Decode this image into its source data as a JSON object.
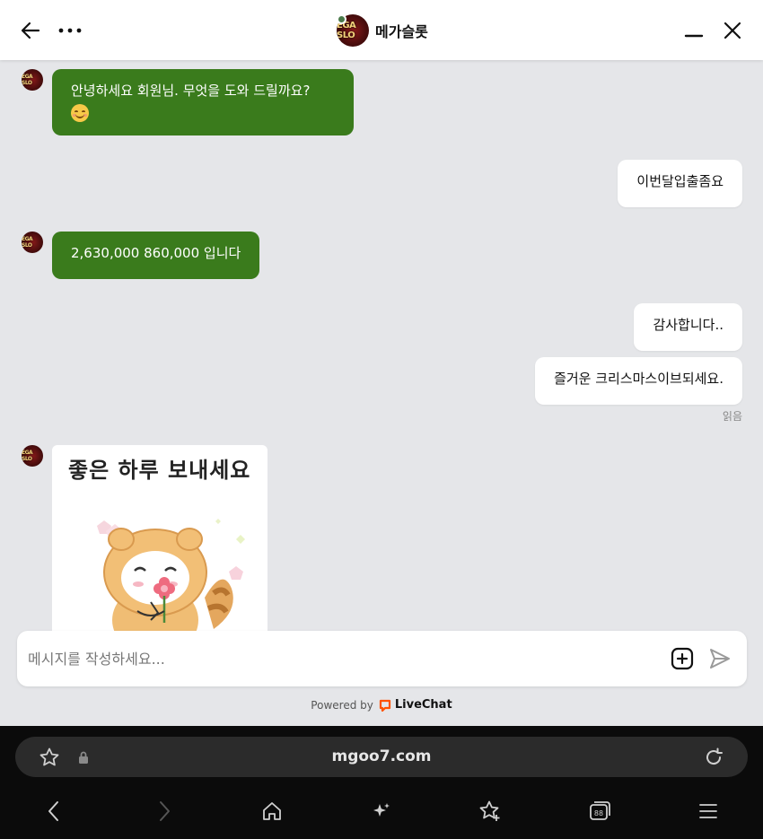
{
  "header": {
    "title": "메가슬롯",
    "avatar_text": "EGA SLO"
  },
  "messages": [
    {
      "from": "agent",
      "text": "안녕하세요 회원님. 무엇을 도와 드릴까요?"
    },
    {
      "from": "user",
      "text": "이번달입출좀요"
    },
    {
      "from": "agent",
      "text": "2,630,000 860,000 입니다"
    },
    {
      "from": "user",
      "text": "감사합니다.."
    },
    {
      "from": "user",
      "text": "즐거운 크리스마스이브되세요."
    },
    {
      "from": "agent",
      "sticker_text": "좋은 하루 보내세요"
    }
  ],
  "read_status": "읽음",
  "composer": {
    "placeholder": "메시지를 작성하세요..."
  },
  "powered": {
    "label": "Powered by",
    "brand": "LiveChat"
  },
  "browser": {
    "url": "mgoo7.com"
  },
  "colors": {
    "agent_bubble": "#3a7b1c",
    "user_bubble": "#ffffff",
    "chat_background": "#e5e6e9",
    "livechat_orange": "#ff5100"
  }
}
